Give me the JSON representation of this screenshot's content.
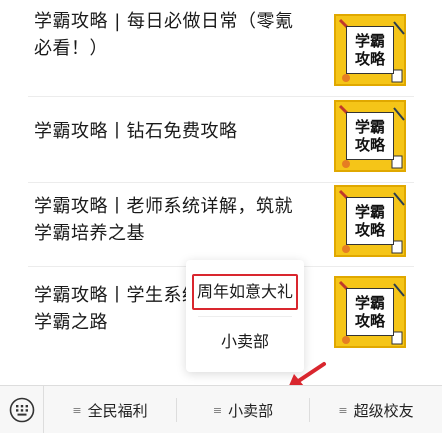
{
  "articles": [
    {
      "title": "学霸攻略 | 每日必做日常（零氪必看！）",
      "thumb": {
        "line1": "学霸",
        "line2": "攻略"
      }
    },
    {
      "title": "学霸攻略丨钻石免费攻略",
      "thumb": {
        "line1": "学霸",
        "line2": "攻略"
      }
    },
    {
      "title": "学霸攻略丨老师系统详解，筑就学霸培养之基",
      "thumb": {
        "line1": "学霸",
        "line2": "攻略"
      }
    },
    {
      "title": "学霸攻略丨学生系统详解，开启学霸之路",
      "thumb": {
        "line1": "学霸",
        "line2": "攻略"
      }
    }
  ],
  "popup": {
    "items": [
      "周年如意大礼",
      "小卖部"
    ]
  },
  "tabbar": {
    "tabs": [
      "全民福利",
      "小卖部",
      "超级校友"
    ]
  },
  "icons": {
    "keyboard": "keyboard-icon",
    "menu": "menu-icon",
    "arrow": "red-arrow-icon"
  },
  "colors": {
    "highlight": "#d9262e",
    "thumb_bg": "#f5c518"
  }
}
